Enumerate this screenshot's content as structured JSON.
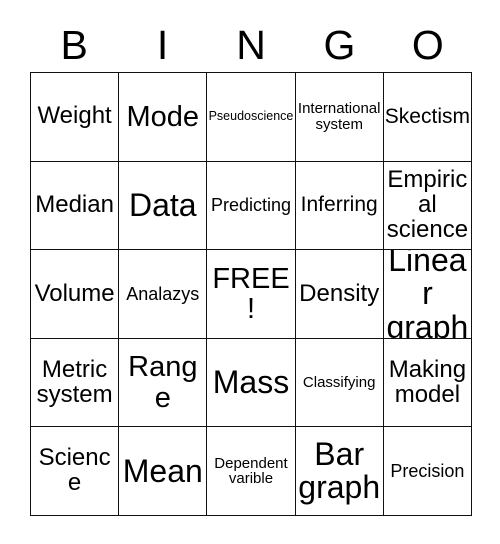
{
  "card": {
    "background_color": "#ffffff",
    "text_color": "#000000",
    "border_color": "#111111"
  },
  "header": {
    "letters": [
      "B",
      "I",
      "N",
      "G",
      "O"
    ]
  },
  "grid": {
    "columns": 5,
    "rows": 5,
    "free_space": "FREE!",
    "cells": [
      {
        "text": "Weight",
        "size": "fs-md"
      },
      {
        "text": "Mode",
        "size": "fs-lg"
      },
      {
        "text": "Pseudoscience",
        "size": "fs-tiny"
      },
      {
        "text": "International\nsystem",
        "size": "fs-xxs"
      },
      {
        "text": "Skectism",
        "size": "fs-sm"
      },
      {
        "text": "Median",
        "size": "fs-md"
      },
      {
        "text": "Data",
        "size": "fs-xl"
      },
      {
        "text": "Predicting",
        "size": "fs-xs"
      },
      {
        "text": "Inferring",
        "size": "fs-sm"
      },
      {
        "text": "Empirical\nscience",
        "size": "fs-md"
      },
      {
        "text": "Volume",
        "size": "fs-md"
      },
      {
        "text": "Analazys",
        "size": "fs-xs"
      },
      {
        "text": "FREE!",
        "size": "fs-lg"
      },
      {
        "text": "Density",
        "size": "fs-md"
      },
      {
        "text": "Linear\ngraph",
        "size": "fs-xl"
      },
      {
        "text": "Metric\nsystem",
        "size": "fs-md"
      },
      {
        "text": "Range",
        "size": "fs-lg"
      },
      {
        "text": "Mass",
        "size": "fs-xl"
      },
      {
        "text": "Classifying",
        "size": "fs-xxs"
      },
      {
        "text": "Making\nmodel",
        "size": "fs-md"
      },
      {
        "text": "Science",
        "size": "fs-md"
      },
      {
        "text": "Mean",
        "size": "fs-xl"
      },
      {
        "text": "Dependent\nvarible",
        "size": "fs-xxs"
      },
      {
        "text": "Bar\ngraph",
        "size": "fs-xl"
      },
      {
        "text": "Precision",
        "size": "fs-xs"
      }
    ]
  }
}
